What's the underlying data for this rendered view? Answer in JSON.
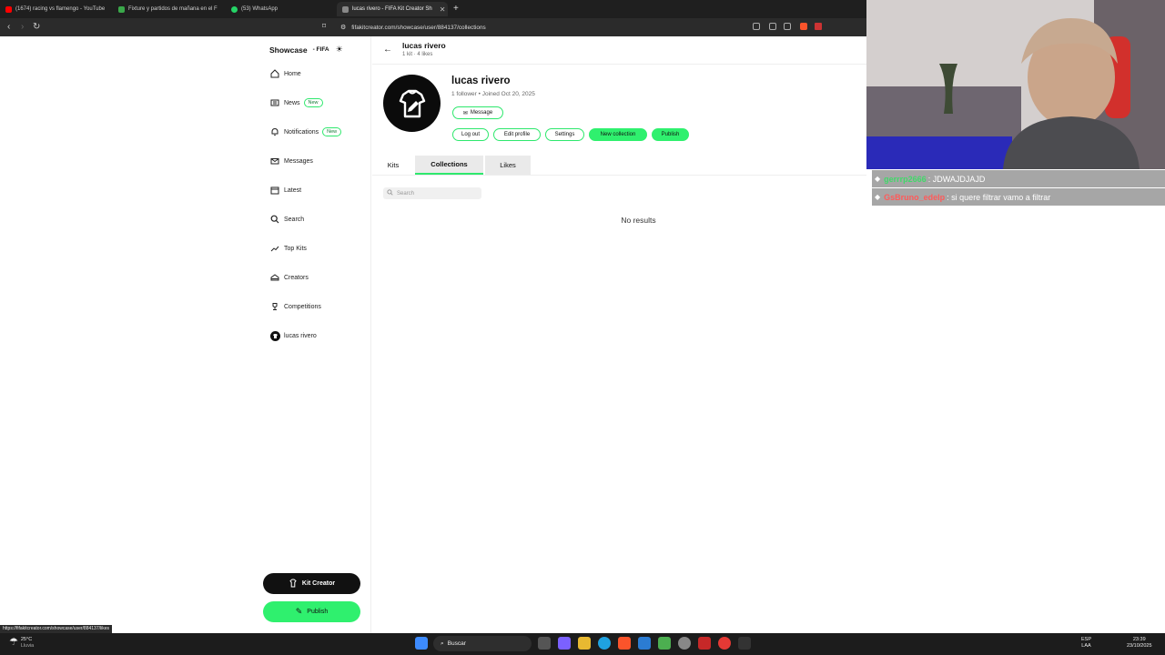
{
  "browser": {
    "tabs": [
      {
        "label": "(1674) racing vs flamengo - YouTube",
        "color": "#ff0000"
      },
      {
        "label": "Fixture y partidos de mañana en el F",
        "color": "#3aa84a"
      },
      {
        "label": "(53) WhatsApp",
        "color": "#25d366"
      },
      {
        "label": "lucas rivero - FIFA Kit Creator Sh",
        "color": "#888888"
      }
    ],
    "new_tab": "+",
    "url": "fifakitcreator.com/showcase/user/884137/collections",
    "status_url": "https://fifakitcreator.com/showcase/user/884137/likes"
  },
  "sidebar": {
    "brand": "Showcase",
    "brand_sub": "- FIFA",
    "items": [
      {
        "label": "Home",
        "icon": "home-icon"
      },
      {
        "label": "News",
        "icon": "news-icon",
        "badge": "New"
      },
      {
        "label": "Notifications",
        "icon": "bell-icon",
        "badge": "New"
      },
      {
        "label": "Messages",
        "icon": "mail-icon"
      },
      {
        "label": "Latest",
        "icon": "calendar-icon"
      },
      {
        "label": "Search",
        "icon": "search-icon"
      },
      {
        "label": "Top Kits",
        "icon": "trending-icon"
      },
      {
        "label": "Creators",
        "icon": "creators-icon"
      },
      {
        "label": "Competitions",
        "icon": "trophy-icon"
      },
      {
        "label": "lucas rivero",
        "icon": "avatar-icon"
      }
    ],
    "kit_creator": "Kit Creator",
    "publish": "Publish"
  },
  "profile": {
    "header_name": "lucas rivero",
    "header_stats": "1 kit · 4 likes",
    "name": "lucas rivero",
    "meta": "1 follower • Joined Oct 20, 2025",
    "message": "Message",
    "buttons": {
      "logout": "Log out",
      "edit": "Edit profile",
      "settings": "Settings",
      "new_collection": "New collection",
      "publish": "Publish"
    },
    "tabs": {
      "kits": "Kits",
      "collections": "Collections",
      "likes": "Likes"
    },
    "search_placeholder": "Search",
    "empty": "No results"
  },
  "chat": [
    {
      "user": "gerrrp2666",
      "message": ": JDWAJDJAJD",
      "color": "#41d96a"
    },
    {
      "user": "GsBruno_edelp",
      "message": ": si quere filtrar vamo a filtrar",
      "color": "#ff5a5a"
    }
  ],
  "taskbar": {
    "weather_temp": "25°C",
    "weather_desc": "Lluvia",
    "search": "Buscar",
    "lang_top": "ESP",
    "lang_bottom": "LAA",
    "time": "23:39",
    "date": "23/10/2025"
  },
  "colors": {
    "accent": "#2ff06e",
    "dark": "#111111"
  }
}
